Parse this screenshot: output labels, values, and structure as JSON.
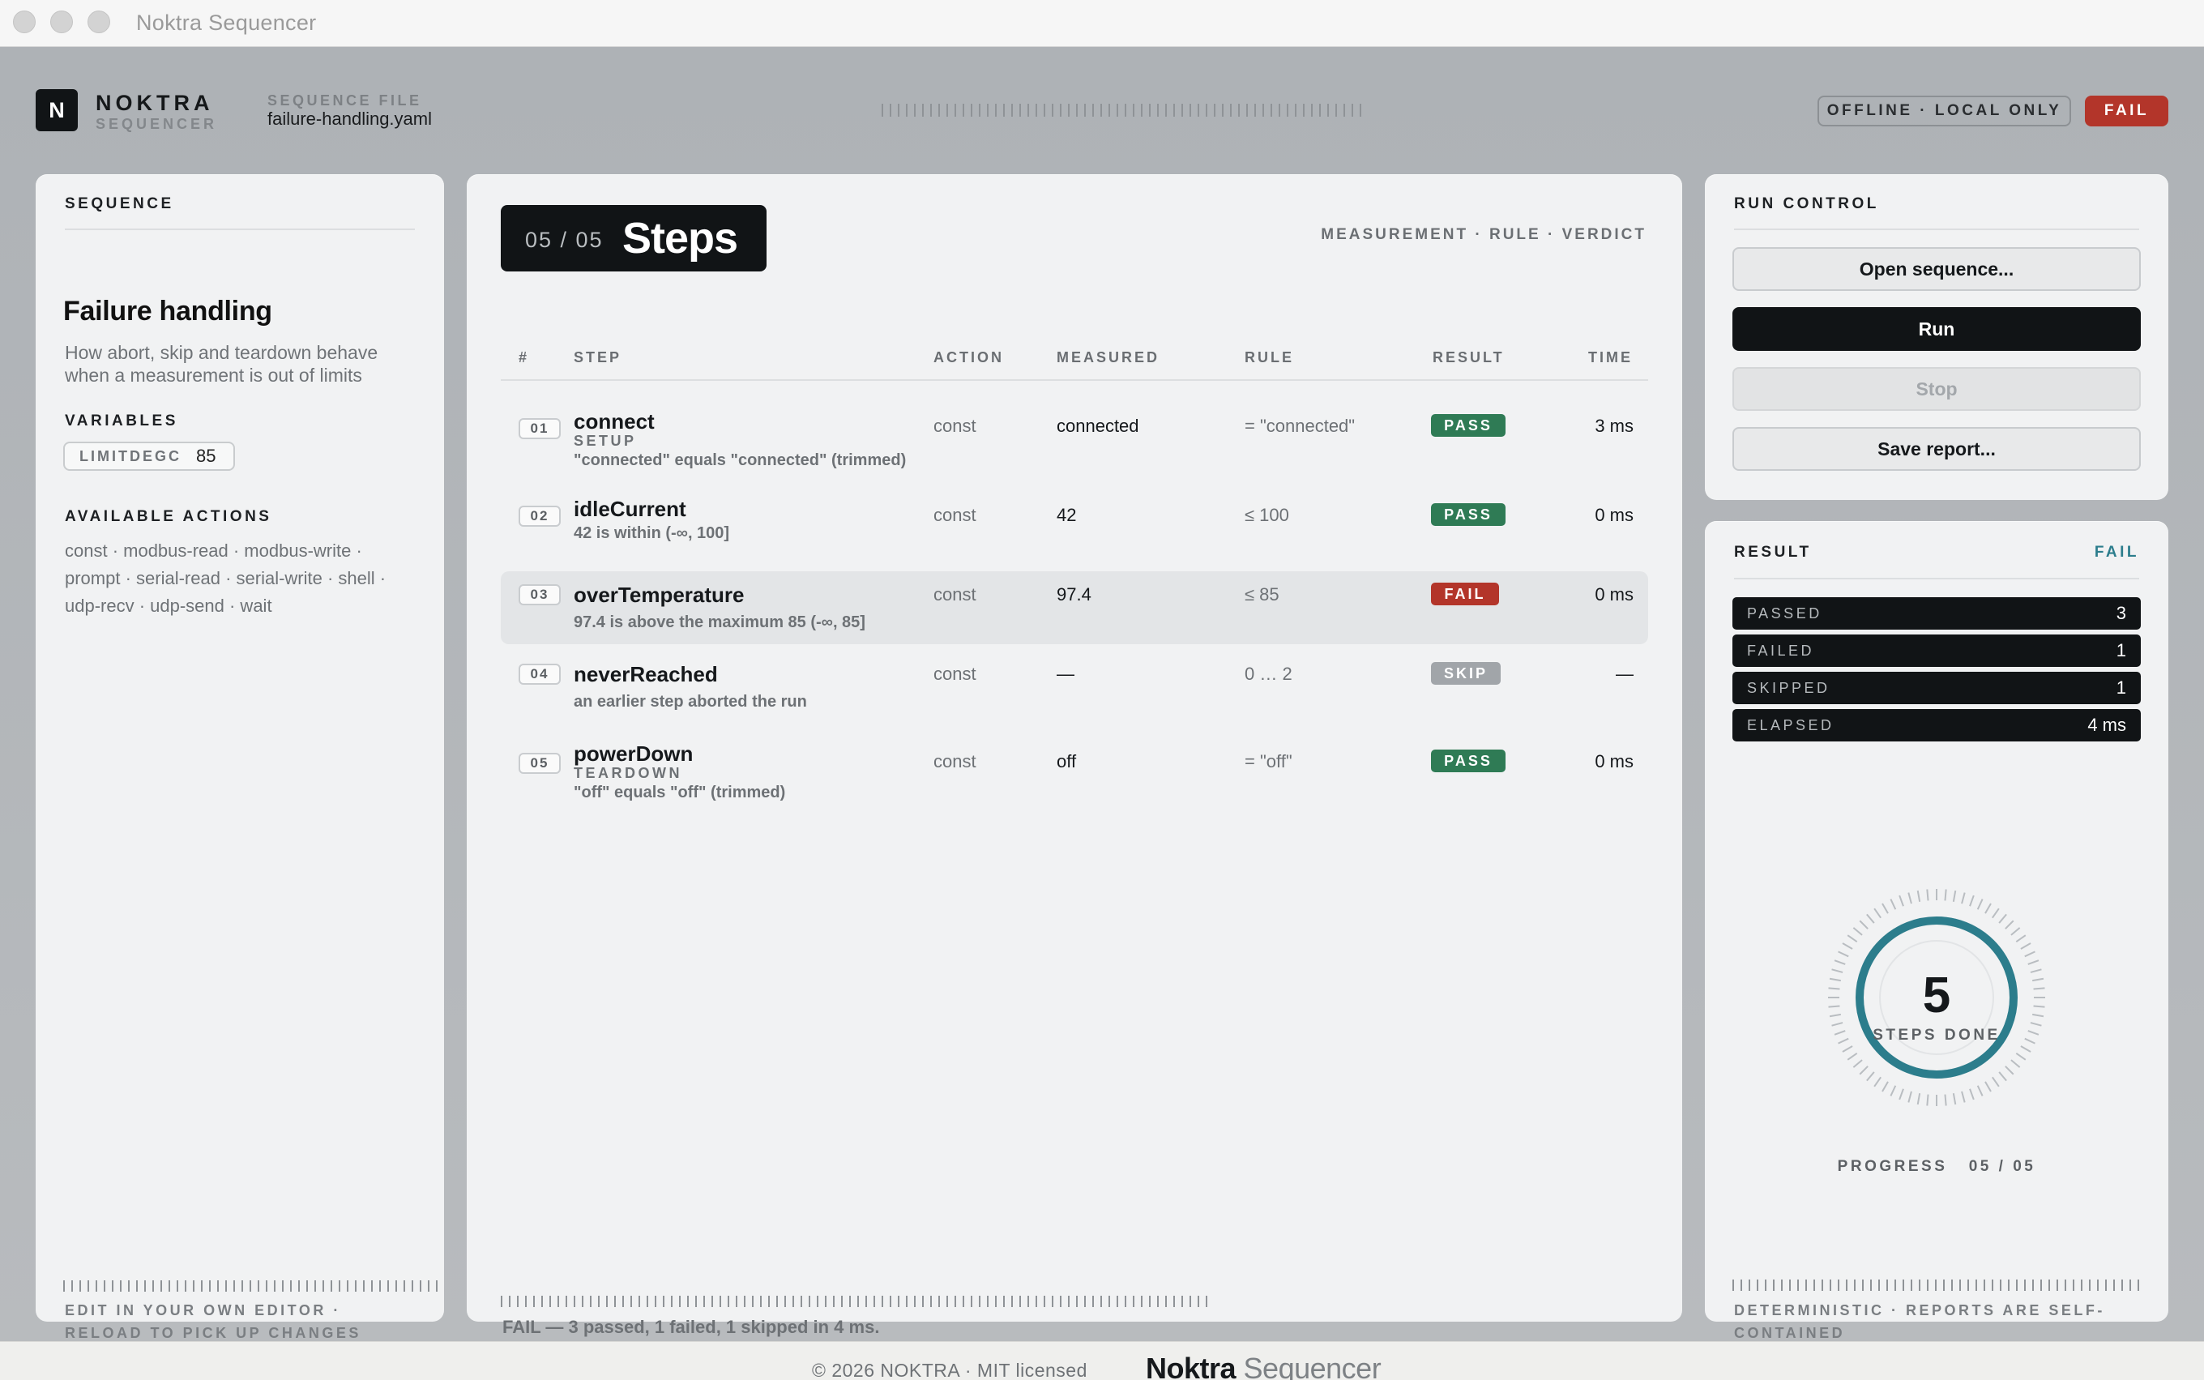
{
  "window": {
    "title": "Noktra Sequencer"
  },
  "header": {
    "logo_letter": "N",
    "brand_name": "NOKTRA",
    "brand_sub": "SEQUENCER",
    "file_label": "SEQUENCE FILE",
    "file_name": "failure-handling.yaml",
    "mode_pill": "OFFLINE · LOCAL ONLY",
    "status_pill": "FAIL"
  },
  "sequence": {
    "section_title": "SEQUENCE",
    "name": "Failure handling",
    "description": "How abort, skip and teardown behave when a measurement is out of limits",
    "variables_title": "VARIABLES",
    "variables": [
      {
        "key": "LIMITDEGC",
        "value": "85"
      }
    ],
    "actions_title": "AVAILABLE ACTIONS",
    "actions_text": "const · modbus-read · modbus-write · prompt · serial-read · serial-write · shell · udp-recv · udp-send · wait",
    "footer_line1": "EDIT IN YOUR OWN EDITOR ·",
    "footer_line2": "RELOAD TO PICK UP CHANGES"
  },
  "steps": {
    "count": "05 / 05",
    "title": "Steps",
    "legend": "MEASUREMENT · RULE · VERDICT",
    "columns": {
      "num": "#",
      "step": "STEP",
      "action": "ACTION",
      "measured": "MEASURED",
      "rule": "RULE",
      "result": "RESULT",
      "time": "TIME"
    },
    "rows": [
      {
        "idx": "01",
        "name": "connect",
        "tag": "SETUP",
        "note": "\"connected\" equals \"connected\" (trimmed)",
        "action": "const",
        "measured": "connected",
        "rule": "= \"connected\"",
        "result": "PASS",
        "time": "3 ms"
      },
      {
        "idx": "02",
        "name": "idleCurrent",
        "tag": "",
        "note": "42 is within (-∞, 100]",
        "action": "const",
        "measured": "42",
        "rule": "≤ 100",
        "result": "PASS",
        "time": "0 ms"
      },
      {
        "idx": "03",
        "name": "overTemperature",
        "tag": "",
        "note": "97.4 is above the maximum 85 (-∞, 85]",
        "action": "const",
        "measured": "97.4",
        "rule": "≤ 85",
        "result": "FAIL",
        "time": "0 ms"
      },
      {
        "idx": "04",
        "name": "neverReached",
        "tag": "",
        "note": "an earlier step aborted the run",
        "action": "const",
        "measured": "—",
        "rule": "0 … 2",
        "result": "SKIP",
        "time": "—"
      },
      {
        "idx": "05",
        "name": "powerDown",
        "tag": "TEARDOWN",
        "note": "\"off\" equals \"off\" (trimmed)",
        "action": "const",
        "measured": "off",
        "rule": "= \"off\"",
        "result": "PASS",
        "time": "0 ms"
      }
    ],
    "summary": "FAIL — 3 passed, 1 failed, 1 skipped in 4 ms."
  },
  "run_control": {
    "title": "RUN CONTROL",
    "open": "Open sequence...",
    "run": "Run",
    "stop": "Stop",
    "save": "Save report..."
  },
  "result": {
    "title": "RESULT",
    "verdict": "FAIL",
    "stats": [
      {
        "label": "PASSED",
        "value": "3"
      },
      {
        "label": "FAILED",
        "value": "1"
      },
      {
        "label": "SKIPPED",
        "value": "1"
      },
      {
        "label": "ELAPSED",
        "value": "4 ms"
      }
    ],
    "steps_done": "5",
    "steps_done_label": "STEPS DONE",
    "progress_label": "PROGRESS",
    "progress_value": "05 / 05",
    "progress_fraction": 1.0,
    "footer_line1": "DETERMINISTIC · REPORTS ARE SELF-",
    "footer_line2": "CONTAINED"
  },
  "footer": {
    "copyright": "© 2026 NOKTRA · MIT licensed",
    "brand_a": "Noktra",
    "brand_b": "Sequencer"
  },
  "colors": {
    "pass": "#2f7b55",
    "fail": "#b3352a",
    "skip": "#a1a5a9",
    "accent": "#2c7d8c"
  }
}
